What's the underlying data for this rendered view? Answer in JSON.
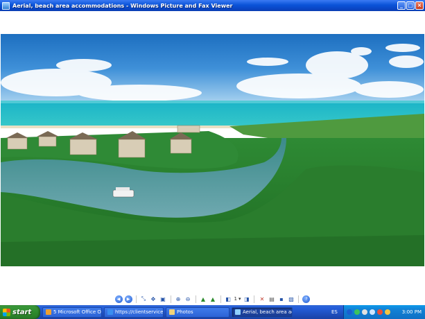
{
  "window": {
    "title": "Aerial, beach area accommodations - Windows Picture and Fax Viewer",
    "buttons": {
      "minimize": "_",
      "maximize": "□",
      "close": "×"
    }
  },
  "photo": {
    "subject": ""
  },
  "toolbar": {
    "page": "1",
    "page_arrow": "▾",
    "icons": [
      "previous-image-icon",
      "next-image-icon",
      "best-fit-icon",
      "actual-size-icon",
      "slideshow-icon",
      "zoom-in-icon",
      "zoom-out-icon",
      "rotate-clockwise-icon",
      "rotate-counterclockwise-icon",
      "previous-page-icon",
      "next-page-icon",
      "delete-icon",
      "print-icon",
      "save-icon",
      "open-in-editor-icon",
      "help-icon"
    ]
  },
  "taskbar": {
    "start_label": "start",
    "tasks": [
      {
        "label": "5 Microsoft Office O...",
        "color": "#f0a030"
      },
      {
        "label": "https://clientservices...",
        "color": "#3a8ef0"
      },
      {
        "label": "Photos",
        "color": "#f2d27a"
      },
      {
        "label": "Aerial, beach area ac...",
        "color": "#8fd0ff",
        "active": true
      }
    ],
    "language": "ES",
    "clock": "3:00 PM"
  },
  "colors": {
    "titlebar": "#0a53d8",
    "taskbar": "#245edb",
    "start": "#2e8b2e",
    "tray": "#0f6fc4"
  }
}
